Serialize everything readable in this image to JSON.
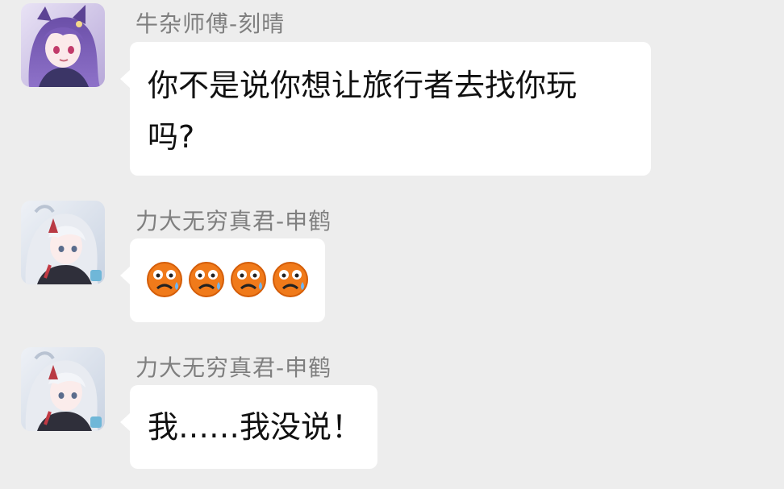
{
  "messages": [
    {
      "sender": "牛杂师傅-刻晴",
      "text": "你不是说你想让旅行者去找你玩\n吗?",
      "avatar": "keqing-avatar"
    },
    {
      "sender": "力大无穷真君-申鹤",
      "emoji": [
        "sweating-frown-emoji",
        "sweating-frown-emoji",
        "sweating-frown-emoji",
        "sweating-frown-emoji"
      ],
      "avatar": "shenhe-avatar"
    },
    {
      "sender": "力大无穷真君-申鹤",
      "text": "我……我没说！",
      "avatar": "shenhe-avatar"
    }
  ],
  "colors": {
    "background": "#ededed",
    "bubble": "#ffffff",
    "sender_text": "#7f7f7f",
    "message_text": "#111111"
  }
}
